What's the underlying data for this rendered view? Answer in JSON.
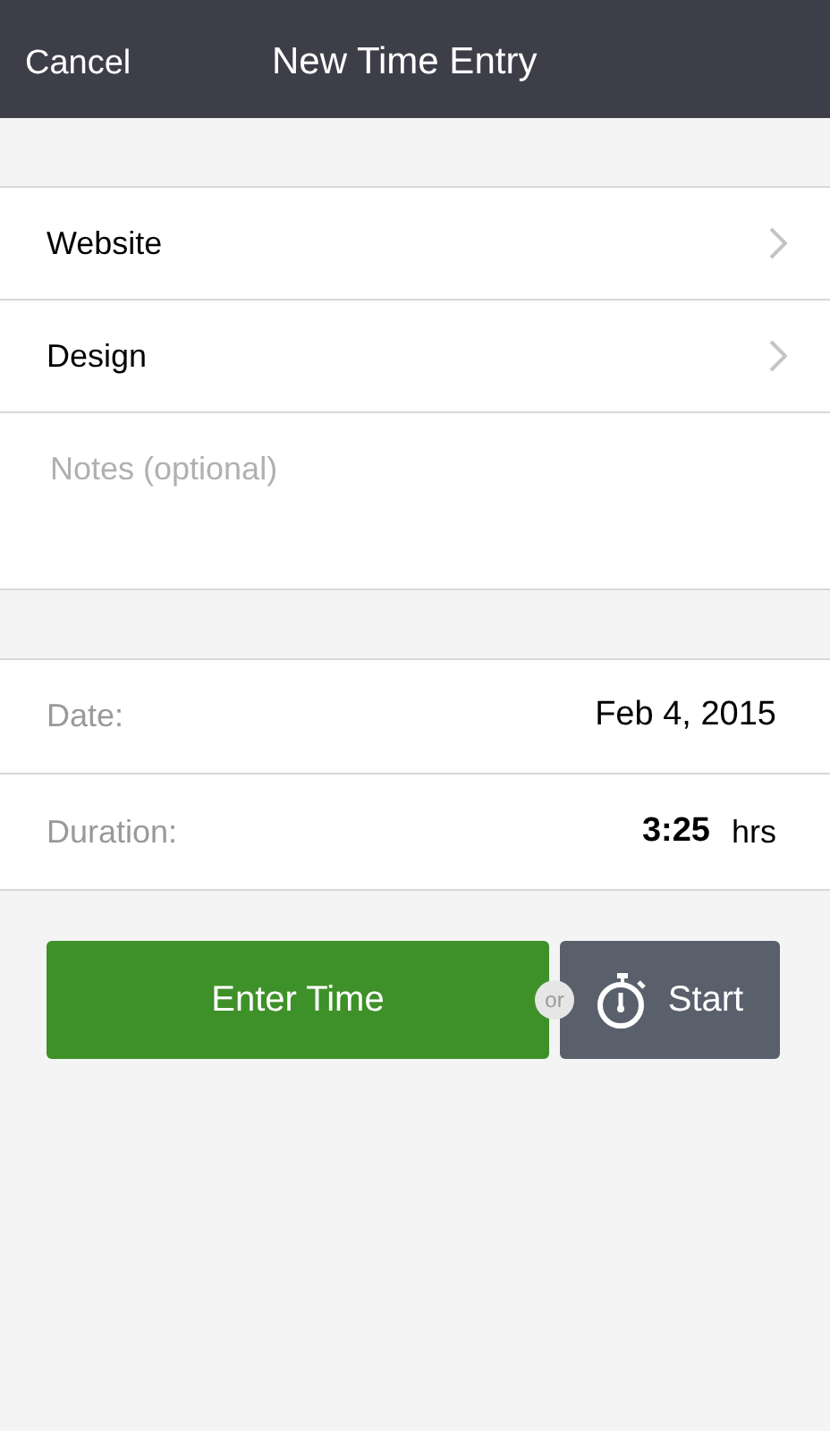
{
  "nav_bar": {
    "cancel": "Cancel",
    "title": "New Time Entry"
  },
  "selectors": [
    {
      "label": "Website"
    },
    {
      "label": "Design"
    }
  ],
  "notes": {
    "placeholder": "Notes (optional)"
  },
  "fields": [
    {
      "label": "Date:",
      "value": "Feb 4, 2015"
    },
    {
      "label": "Duration:",
      "value": "3:25",
      "unit": "hrs"
    }
  ],
  "actions": {
    "enter": "Enter Time",
    "or": "or",
    "start": "Start"
  }
}
